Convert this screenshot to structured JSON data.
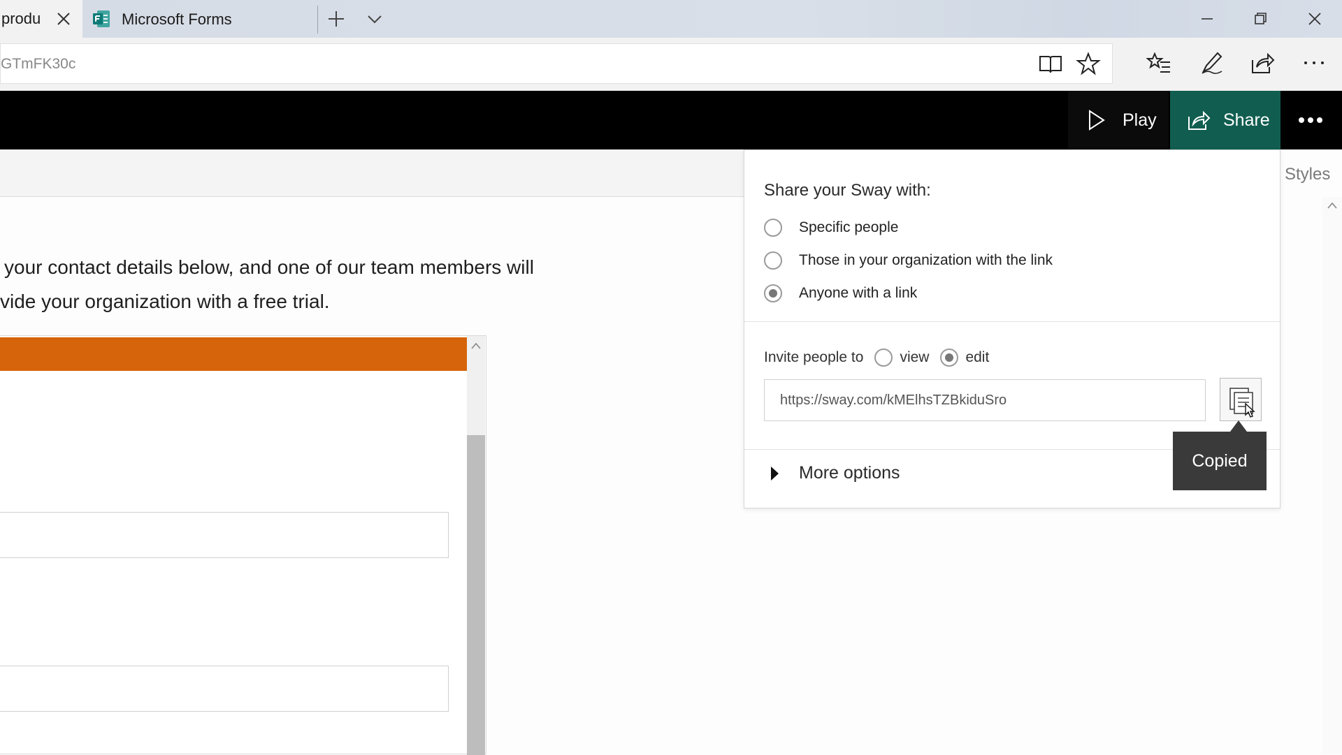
{
  "browser": {
    "tabs": [
      {
        "title": "produ"
      },
      {
        "title": "Microsoft Forms"
      }
    ],
    "address": "GTmFK30c"
  },
  "sway": {
    "play_label": "Play",
    "share_label": "Share",
    "styles_label": "Styles",
    "accent": "#115e50"
  },
  "content": {
    "line1": "your contact details below, and one of our team members will",
    "line2": "vide your organization with a free trial.",
    "banner_color": "#d6640a"
  },
  "share_panel": {
    "heading": "Share your Sway with:",
    "options": [
      {
        "label": "Specific people",
        "selected": false
      },
      {
        "label": "Those in your organization with the link",
        "selected": false
      },
      {
        "label": "Anyone with a link",
        "selected": true
      }
    ],
    "invite_label": "Invite people to",
    "invite_view": "view",
    "invite_edit": "edit",
    "invite_selected": "edit",
    "link": "https://sway.com/kMElhsTZBkiduSro",
    "copied_tooltip": "Copied",
    "more_options": "More options"
  }
}
